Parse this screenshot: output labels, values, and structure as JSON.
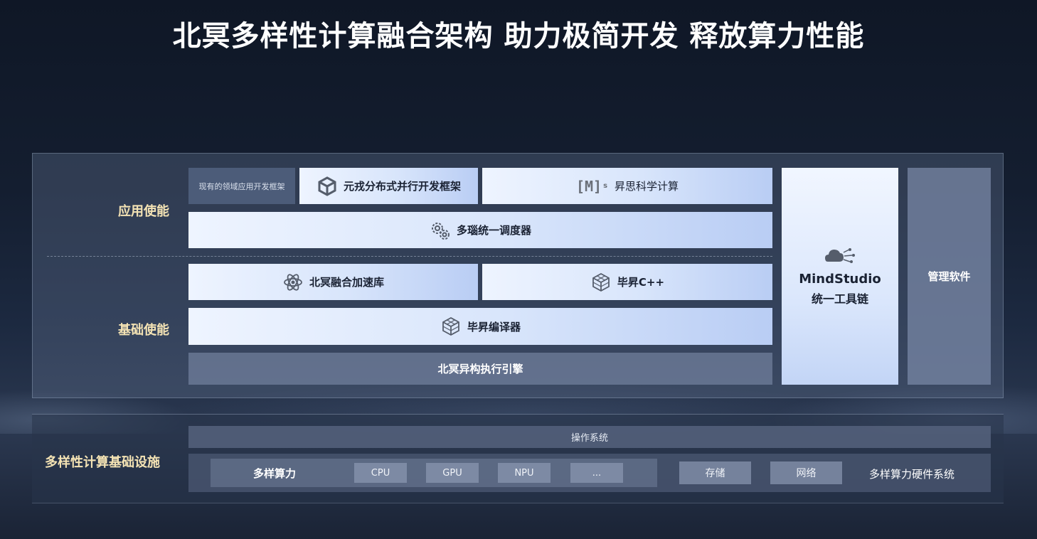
{
  "title": "北冥多样性计算融合架构  助力极简开发  释放算力性能",
  "sections": {
    "app_enable": "应用使能",
    "base_enable": "基础使能",
    "infra": "多样性计算基础设施"
  },
  "app_layer": {
    "existing_frameworks": "现有的领域应用开发框架",
    "yuanrong": "元戎分布式并行开发框架",
    "ms_logo": "[M]",
    "ms_logo_sup": "s",
    "yisi": "昇思科学计算",
    "scheduler": "多瑙统一调度器"
  },
  "base_layer": {
    "accel_lib": "北冥融合加速库",
    "bisheng_cpp": "毕昇C++",
    "compiler": "毕昇编译器",
    "engine": "北冥异构执行引擎"
  },
  "mindstudio": {
    "title": "MindStudio",
    "subtitle": "统一工具链"
  },
  "management": "管理软件",
  "infra_layer": {
    "os": "操作系统",
    "compute_label": "多样算力",
    "chips": [
      "CPU",
      "GPU",
      "NPU",
      "..."
    ],
    "storage": "存储",
    "network": "网络",
    "hardware_system": "多样算力硬件系统"
  },
  "colors": {
    "section_label": "#f4e3b4",
    "light_box": "#d8e5fb",
    "background": "#141e30"
  },
  "icons": [
    "cube-icon",
    "gears-icon",
    "atom-icon",
    "blocks-icon",
    "cloud-network-icon"
  ]
}
